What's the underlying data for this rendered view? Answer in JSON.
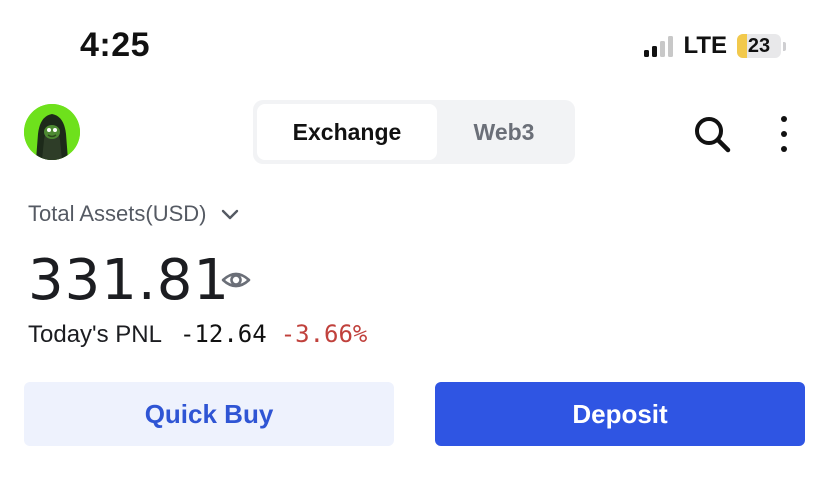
{
  "status_bar": {
    "time": "4:25",
    "network": "LTE",
    "battery": "23",
    "battery_level_percent": 23,
    "signal_bars_active": 2,
    "signal_bars_total": 4
  },
  "header": {
    "avatar_icon": "pepe-avatar-icon",
    "tabs": [
      {
        "label": "Exchange",
        "active": true
      },
      {
        "label": "Web3",
        "active": false
      }
    ],
    "search_icon": "search-icon",
    "more_icon": "more-vertical-icon"
  },
  "assets": {
    "label": "Total Assets(USD)",
    "amount": "331.81",
    "pnl_label": "Today's PNL",
    "pnl_value": "-12.64",
    "pnl_percent": "-3.66%"
  },
  "actions": {
    "quick_buy_label": "Quick Buy",
    "deposit_label": "Deposit"
  },
  "colors": {
    "accent": "#2f55e3",
    "accent_soft": "#eef2fd",
    "negative": "#c0413c",
    "battery_fill": "#f2c94c",
    "avatar_bg": "#6ee11c"
  }
}
